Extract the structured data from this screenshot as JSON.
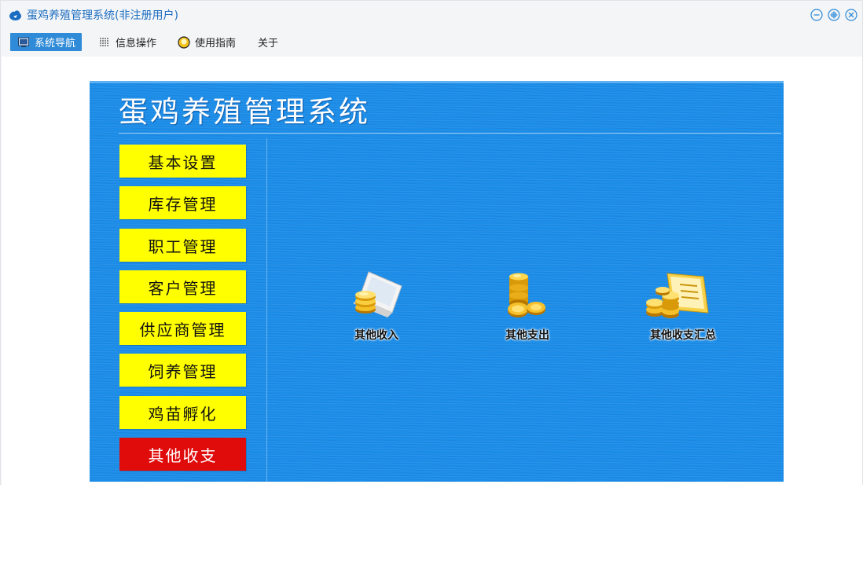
{
  "window": {
    "title": "蛋鸡养殖管理系统(非注册用户)"
  },
  "menubar": {
    "items": [
      {
        "label": "系统导航",
        "icon": "monitor-icon"
      },
      {
        "label": "信息操作",
        "icon": "grid-icon"
      },
      {
        "label": "使用指南",
        "icon": "bulb-icon"
      },
      {
        "label": "关于"
      }
    ]
  },
  "panel": {
    "title": "蛋鸡养殖管理系统",
    "nav": [
      "基本设置",
      "库存管理",
      "职工管理",
      "客户管理",
      "供应商管理",
      "饲养管理",
      "鸡苗孵化",
      "其他收支"
    ],
    "functions": [
      {
        "label": "其他收入",
        "icon": "laptop-coins-icon"
      },
      {
        "label": "其他支出",
        "icon": "coin-stack-icon"
      },
      {
        "label": "其他收支汇总",
        "icon": "ledger-coins-icon"
      }
    ]
  },
  "colors": {
    "accent": "#2f8bd8",
    "panel_blue": "#1c8de8",
    "nav_yellow": "#ffff00",
    "nav_selected_red": "#e00b0b"
  }
}
